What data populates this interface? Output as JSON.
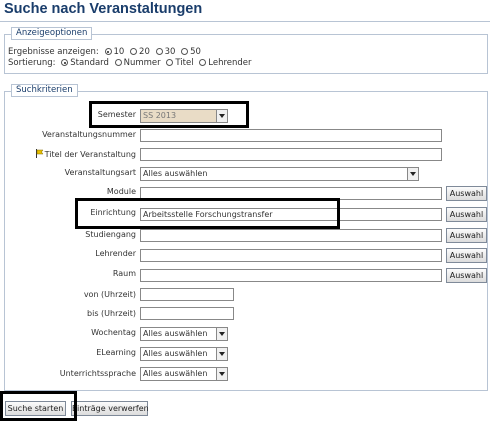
{
  "page": {
    "title": "Suche nach Veranstaltungen"
  },
  "display_options": {
    "legend": "Anzeigeoptionen",
    "results_label": "Ergebnisse anzeigen:",
    "results_options": [
      "10",
      "20",
      "30",
      "50"
    ],
    "results_selected": "10",
    "sort_label": "Sortierung:",
    "sort_options": [
      "Standard",
      "Nummer",
      "Titel",
      "Lehrender"
    ],
    "sort_selected": "Standard"
  },
  "criteria": {
    "legend": "Suchkriterien",
    "semester": {
      "label": "Semester",
      "value": "SS 2013"
    },
    "event_number": {
      "label": "Veranstaltungsnummer",
      "value": ""
    },
    "event_title": {
      "label": "Titel der Veranstaltung",
      "value": ""
    },
    "event_type": {
      "label": "Veranstaltungsart",
      "value": "Alles auswählen"
    },
    "modules": {
      "label": "Module",
      "value": "",
      "button": "Auswahl"
    },
    "institution": {
      "label": "Einrichtung",
      "value": "Arbeitsstelle Forschungstransfer",
      "button": "Auswahl"
    },
    "course_of_study": {
      "label": "Studiengang",
      "value": "",
      "button": "Auswahl"
    },
    "lecturer": {
      "label": "Lehrender",
      "value": "",
      "button": "Auswahl"
    },
    "room": {
      "label": "Raum",
      "value": "",
      "button": "Auswahl"
    },
    "time_from": {
      "label": "von (Uhrzeit)",
      "value": ""
    },
    "time_to": {
      "label": "bis (Uhrzeit)",
      "value": ""
    },
    "weekday": {
      "label": "Wochentag",
      "value": "Alles auswählen"
    },
    "elearning": {
      "label": "ELearning",
      "value": "Alles auswählen"
    },
    "language": {
      "label": "Unterrichtssprache",
      "value": "Alles auswählen"
    }
  },
  "actions": {
    "search": "Suche starten",
    "reset": "Einträge verwerfen"
  },
  "colors": {
    "title": "#1a3d6b",
    "border": "#b8c4d4",
    "highlight": "#000000",
    "disabled_select": "#e9dcc6"
  }
}
